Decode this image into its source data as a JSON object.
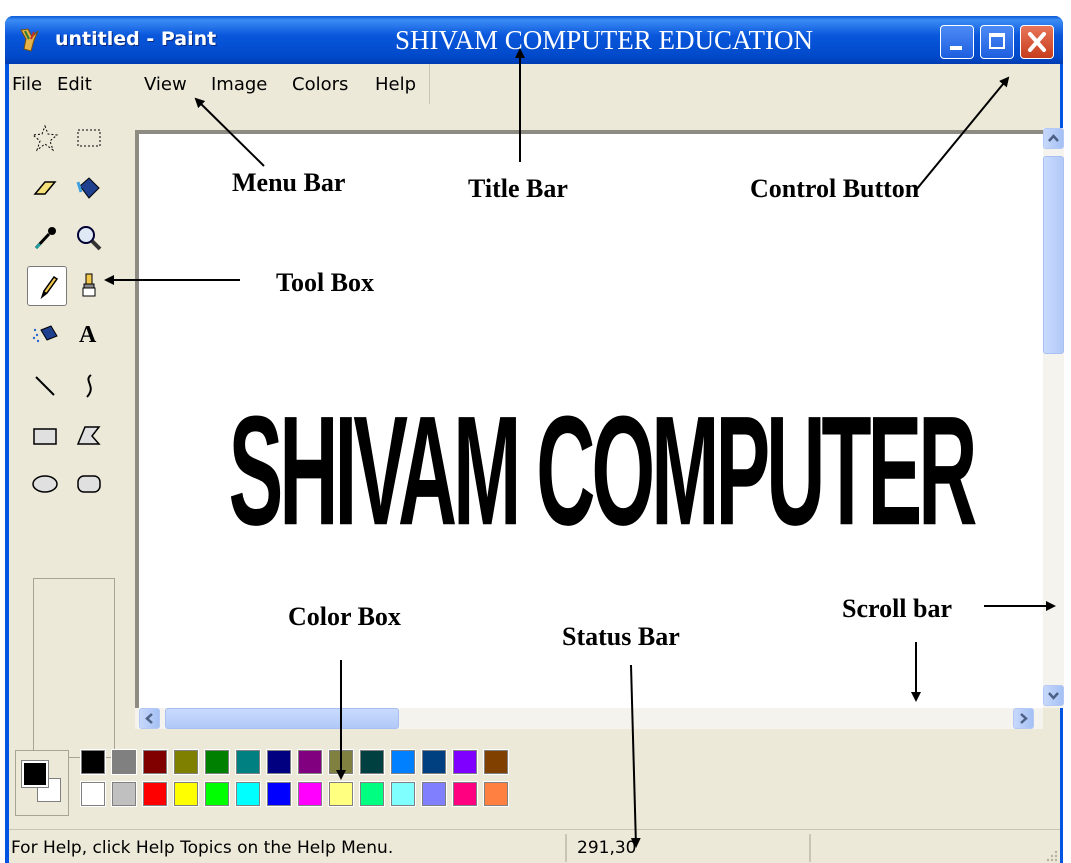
{
  "window": {
    "title": "untitled - Paint",
    "overlay_title": "SHIVAM COMPUTER EDUCATION",
    "controls": [
      "minimize",
      "maximize",
      "close"
    ]
  },
  "menubar": {
    "items": [
      {
        "label": "File"
      },
      {
        "label": "Edit"
      },
      {
        "label": "View"
      },
      {
        "label": "Image"
      },
      {
        "label": "Colors"
      },
      {
        "label": "Help"
      }
    ]
  },
  "toolbox": {
    "tools": [
      {
        "name": "free-form-select-icon"
      },
      {
        "name": "select-icon"
      },
      {
        "name": "eraser-icon"
      },
      {
        "name": "fill-with-color-icon"
      },
      {
        "name": "pick-color-icon"
      },
      {
        "name": "magnifier-icon"
      },
      {
        "name": "pencil-icon",
        "selected": true
      },
      {
        "name": "brush-icon"
      },
      {
        "name": "airbrush-icon"
      },
      {
        "name": "text-icon",
        "glyph": "A"
      },
      {
        "name": "line-icon"
      },
      {
        "name": "curve-icon"
      },
      {
        "name": "rectangle-icon"
      },
      {
        "name": "polygon-icon"
      },
      {
        "name": "ellipse-icon"
      },
      {
        "name": "rounded-rectangle-icon"
      }
    ]
  },
  "canvas": {
    "text": "SHIVAM COMPUTER"
  },
  "palette": {
    "foreground": "#000000",
    "background": "#ffffff",
    "top_row": [
      "#000000",
      "#808080",
      "#800000",
      "#808000",
      "#008000",
      "#008080",
      "#000080",
      "#800080",
      "#808040",
      "#004040",
      "#0080ff",
      "#004080",
      "#8000ff",
      "#804000"
    ],
    "bottom_row": [
      "#ffffff",
      "#c0c0c0",
      "#ff0000",
      "#ffff00",
      "#00ff00",
      "#00ffff",
      "#0000ff",
      "#ff00ff",
      "#ffff80",
      "#00ff80",
      "#80ffff",
      "#8080ff",
      "#ff0080",
      "#ff8040"
    ]
  },
  "statusbar": {
    "help_text": "For Help, click Help Topics on the Help Menu.",
    "coordinates": "291,30"
  },
  "annotations": {
    "menu_bar": "Menu Bar",
    "title_bar": "Title Bar",
    "control_button": "Control Button",
    "tool_box": "Tool Box",
    "color_box": "Color Box",
    "status_bar": "Status Bar",
    "scroll_bar": "Scroll bar"
  }
}
